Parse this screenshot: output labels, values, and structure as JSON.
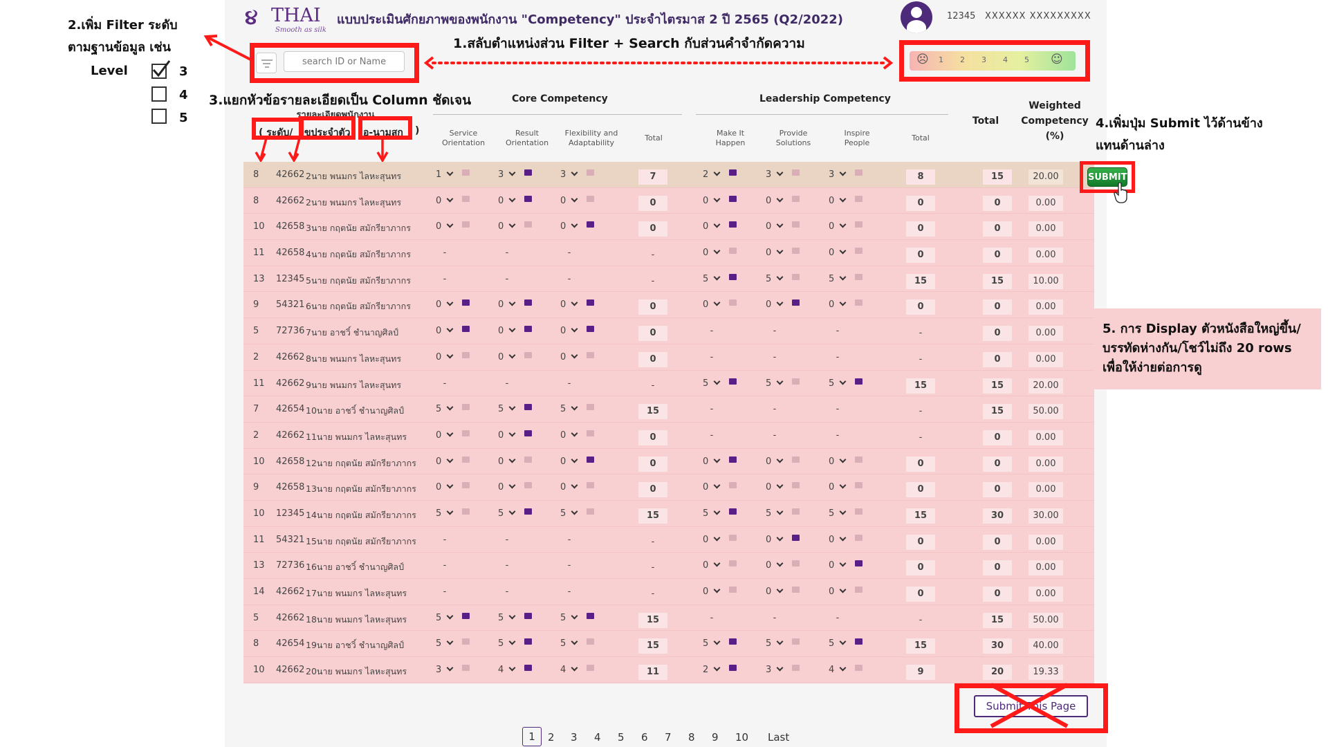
{
  "header": {
    "logo_word": "THAI",
    "logo_tagline": "Smooth as silk",
    "title": "แบบประเมินศักยภาพของพนักงาน \"Competency\" ประจำไตรมาส 2 ปี 2565   (Q2/2022)",
    "user_id": "12345",
    "user_name": "XXXXXX XXXXXXXXX"
  },
  "search": {
    "placeholder": "search ID or Name"
  },
  "legend": {
    "left_face": "☹",
    "scale": [
      "1",
      "2",
      "3",
      "4",
      "5"
    ],
    "right_face": "☺"
  },
  "table": {
    "group_core": "Core Competency",
    "group_leadership": "Leadership Competency",
    "core_cols": [
      "Service\nOrientation",
      "Result\nOrientation",
      "Flexibility and\nAdaptability",
      "Total"
    ],
    "lead_cols": [
      "Make It\nHappen",
      "Provide\nSolutions",
      "Inspire\nPeople",
      "Total"
    ],
    "total_label": "Total",
    "weighted_label": "Weighted\nCompetency\n(%)",
    "left_headers": [
      "( ระดับ/",
      "ขประจำตัว",
      "อ-นามสกุ",
      ")"
    ],
    "overlap_text": "รายละเอียดพนักงาน"
  },
  "rows": [
    {
      "lv": "8",
      "id": "42662",
      "name": "2นาย พนมกร ไลหะสุนทร",
      "core": [
        [
          "1",
          0
        ],
        [
          "3",
          1
        ],
        [
          "3",
          0
        ]
      ],
      "core_total": "7",
      "lead": [
        [
          "2",
          1
        ],
        [
          "3",
          0
        ],
        [
          "3",
          0
        ]
      ],
      "lead_total": "8",
      "total": "15",
      "weighted": "20.00",
      "hl": true
    },
    {
      "lv": "8",
      "id": "42662",
      "name": "2นาย พนมกร ไลหะสุนทร",
      "core": [
        [
          "0",
          0
        ],
        [
          "0",
          1
        ],
        [
          "0",
          0
        ]
      ],
      "core_total": "0",
      "lead": [
        [
          "0",
          1
        ],
        [
          "0",
          0
        ],
        [
          "0",
          0
        ]
      ],
      "lead_total": "0",
      "total": "0",
      "weighted": "0.00"
    },
    {
      "lv": "10",
      "id": "42658",
      "name": "3นาย กฤตนัย สมักรียาภากร",
      "core": [
        [
          "0",
          0
        ],
        [
          "0",
          0
        ],
        [
          "0",
          1
        ]
      ],
      "core_total": "0",
      "lead": [
        [
          "0",
          1
        ],
        [
          "0",
          0
        ],
        [
          "0",
          0
        ]
      ],
      "lead_total": "0",
      "total": "0",
      "weighted": "0.00"
    },
    {
      "lv": "11",
      "id": "42658",
      "name": "4นาย กฤตนัย สมักรียาภากร",
      "core": null,
      "core_total": "-",
      "lead": [
        [
          "0",
          0
        ],
        [
          "0",
          0
        ],
        [
          "0",
          0
        ]
      ],
      "lead_total": "0",
      "total": "0",
      "weighted": "0.00"
    },
    {
      "lv": "13",
      "id": "12345",
      "name": "5นาย กฤตนัย สมักรียาภากร",
      "core": null,
      "core_total": "-",
      "lead": [
        [
          "5",
          1
        ],
        [
          "5",
          0
        ],
        [
          "5",
          0
        ]
      ],
      "lead_total": "15",
      "total": "15",
      "weighted": "10.00"
    },
    {
      "lv": "9",
      "id": "54321",
      "name": "6นาย กฤตนัย สมักรียาภากร",
      "core": [
        [
          "0",
          1
        ],
        [
          "0",
          1
        ],
        [
          "0",
          1
        ]
      ],
      "core_total": "0",
      "lead": [
        [
          "0",
          0
        ],
        [
          "0",
          1
        ],
        [
          "0",
          0
        ]
      ],
      "lead_total": "0",
      "total": "0",
      "weighted": "0.00"
    },
    {
      "lv": "5",
      "id": "72736",
      "name": "7นาย อาชวิ์ ชำนาญศิลป์",
      "core": [
        [
          "0",
          1
        ],
        [
          "0",
          1
        ],
        [
          "0",
          1
        ]
      ],
      "core_total": "0",
      "lead": null,
      "lead_total": "-",
      "total": "0",
      "weighted": "0.00"
    },
    {
      "lv": "2",
      "id": "42662",
      "name": "8นาย พนมกร ไลหะสุนทร",
      "core": [
        [
          "0",
          0
        ],
        [
          "0",
          0
        ],
        [
          "0",
          0
        ]
      ],
      "core_total": "0",
      "lead": null,
      "lead_total": "-",
      "total": "0",
      "weighted": "0.00"
    },
    {
      "lv": "11",
      "id": "42662",
      "name": "9นาย พนมกร ไลหะสุนทร",
      "core": null,
      "core_total": "-",
      "lead": [
        [
          "5",
          1
        ],
        [
          "5",
          0
        ],
        [
          "5",
          1
        ]
      ],
      "lead_total": "15",
      "total": "15",
      "weighted": "20.00"
    },
    {
      "lv": "7",
      "id": "42654",
      "name": "10นาย อาชวิ์ ชำนาญศิลป์",
      "core": [
        [
          "5",
          0
        ],
        [
          "5",
          1
        ],
        [
          "5",
          0
        ]
      ],
      "core_total": "15",
      "lead": null,
      "lead_total": "-",
      "total": "15",
      "weighted": "50.00"
    },
    {
      "lv": "2",
      "id": "42662",
      "name": "11นาย พนมกร ไลหะสุนทร",
      "core": [
        [
          "0",
          0
        ],
        [
          "0",
          1
        ],
        [
          "0",
          0
        ]
      ],
      "core_total": "0",
      "lead": null,
      "lead_total": "-",
      "total": "0",
      "weighted": "0.00"
    },
    {
      "lv": "10",
      "id": "42658",
      "name": "12นาย กฤตนัย สมักรียาภากร",
      "core": [
        [
          "0",
          0
        ],
        [
          "0",
          0
        ],
        [
          "0",
          1
        ]
      ],
      "core_total": "0",
      "lead": [
        [
          "0",
          1
        ],
        [
          "0",
          0
        ],
        [
          "0",
          0
        ]
      ],
      "lead_total": "0",
      "total": "0",
      "weighted": "0.00"
    },
    {
      "lv": "9",
      "id": "42658",
      "name": "13นาย กฤตนัย สมักรียาภากร",
      "core": [
        [
          "0",
          0
        ],
        [
          "0",
          0
        ],
        [
          "0",
          0
        ]
      ],
      "core_total": "0",
      "lead": [
        [
          "0",
          0
        ],
        [
          "0",
          0
        ],
        [
          "0",
          0
        ]
      ],
      "lead_total": "0",
      "total": "0",
      "weighted": "0.00"
    },
    {
      "lv": "10",
      "id": "12345",
      "name": "14นาย กฤตนัย สมักรียาภากร",
      "core": [
        [
          "5",
          0
        ],
        [
          "5",
          1
        ],
        [
          "5",
          0
        ]
      ],
      "core_total": "15",
      "lead": [
        [
          "5",
          1
        ],
        [
          "5",
          0
        ],
        [
          "5",
          0
        ]
      ],
      "lead_total": "15",
      "total": "30",
      "weighted": "30.00"
    },
    {
      "lv": "11",
      "id": "54321",
      "name": "15นาย กฤตนัย สมักรียาภากร",
      "core": null,
      "core_total": "-",
      "lead": [
        [
          "0",
          0
        ],
        [
          "0",
          1
        ],
        [
          "0",
          0
        ]
      ],
      "lead_total": "0",
      "total": "0",
      "weighted": "0.00"
    },
    {
      "lv": "13",
      "id": "72736",
      "name": "16นาย อาชวิ์ ชำนาญศิลป์",
      "core": null,
      "core_total": "-",
      "lead": [
        [
          "0",
          0
        ],
        [
          "0",
          0
        ],
        [
          "0",
          1
        ]
      ],
      "lead_total": "0",
      "total": "0",
      "weighted": "0.00"
    },
    {
      "lv": "14",
      "id": "42662",
      "name": "17นาย พนมกร ไลหะสุนทร",
      "core": null,
      "core_total": "-",
      "lead": [
        [
          "0",
          0
        ],
        [
          "0",
          0
        ],
        [
          "0",
          0
        ]
      ],
      "lead_total": "0",
      "total": "0",
      "weighted": "0.00"
    },
    {
      "lv": "5",
      "id": "42662",
      "name": "18นาย พนมกร ไลหะสุนทร",
      "core": [
        [
          "5",
          1
        ],
        [
          "5",
          1
        ],
        [
          "5",
          1
        ]
      ],
      "core_total": "15",
      "lead": null,
      "lead_total": "-",
      "total": "15",
      "weighted": "50.00"
    },
    {
      "lv": "8",
      "id": "42654",
      "name": "19นาย อาชวิ์ ชำนาญศิลป์",
      "core": [
        [
          "5",
          0
        ],
        [
          "5",
          1
        ],
        [
          "5",
          0
        ]
      ],
      "core_total": "15",
      "lead": [
        [
          "5",
          1
        ],
        [
          "5",
          0
        ],
        [
          "5",
          1
        ]
      ],
      "lead_total": "15",
      "total": "30",
      "weighted": "40.00"
    },
    {
      "lv": "10",
      "id": "42662",
      "name": "20นาย พนมกร ไลหะสุนทร",
      "core": [
        [
          "3",
          0
        ],
        [
          "4",
          1
        ],
        [
          "4",
          0
        ]
      ],
      "core_total": "11",
      "lead": [
        [
          "2",
          1
        ],
        [
          "3",
          0
        ],
        [
          "4",
          0
        ]
      ],
      "lead_total": "9",
      "total": "20",
      "weighted": "19.33"
    }
  ],
  "buttons": {
    "submit": "SUBMIT",
    "submit_page": "Submit This Page"
  },
  "pagination": {
    "pages": [
      "1",
      "2",
      "3",
      "4",
      "5",
      "6",
      "7",
      "8",
      "9",
      "10"
    ],
    "current": "1",
    "last": "Last »"
  },
  "annotations": {
    "a1": "1.สลับตำแหน่งส่วน Filter + Search กับส่วนคำจำกัดความ",
    "a2_line1": "2.เพิ่ม Filter ระดับ",
    "a2_line2": "ตามฐานข้อมูล เช่น",
    "a2_level": "Level",
    "a2_options": [
      {
        "label": "3",
        "checked": true
      },
      {
        "label": "4",
        "checked": false
      },
      {
        "label": "5",
        "checked": false
      }
    ],
    "a3": "3.แยกหัวข้อรายละเอียดเป็น Column ชัดเจน",
    "a4_line1": "4.เพิ่มปุ่ม Submit ไว้ด้านข้าง",
    "a4_line2": "แทนด้านล่าง",
    "a5_line1": "5. การ Display ตัวหนังสือใหญ่ขึ้น/",
    "a5_line2": "บรรทัดห่างกัน/โชว์ไม่ถึง 20 rows",
    "a5_line3": "เพื่อให้ง่ายต่อการดู"
  },
  "colors": {
    "brand": "#5c2d82",
    "annotation_red": "#ff1a1a",
    "row_pink": "#f9d0d2",
    "submit_green": "#1f9b36"
  }
}
